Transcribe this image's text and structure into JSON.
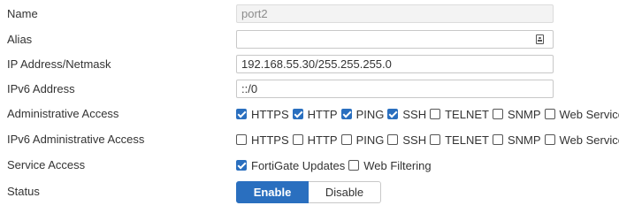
{
  "form": {
    "name": {
      "label": "Name",
      "value": "port2"
    },
    "alias": {
      "label": "Alias",
      "value": "",
      "icon": "address-book-icon"
    },
    "ip_netmask": {
      "label": "IP Address/Netmask",
      "value": "192.168.55.30/255.255.255.0"
    },
    "ipv6_address": {
      "label": "IPv6 Address",
      "value": "::/0"
    },
    "admin_access": {
      "label": "Administrative Access",
      "options": [
        {
          "label": "HTTPS",
          "checked": true
        },
        {
          "label": "HTTP",
          "checked": true
        },
        {
          "label": "PING",
          "checked": true
        },
        {
          "label": "SSH",
          "checked": true
        },
        {
          "label": "TELNET",
          "checked": false
        },
        {
          "label": "SNMP",
          "checked": false
        },
        {
          "label": "Web Service",
          "checked": false
        }
      ]
    },
    "ipv6_admin_access": {
      "label": "IPv6 Administrative Access",
      "options": [
        {
          "label": "HTTPS",
          "checked": false
        },
        {
          "label": "HTTP",
          "checked": false
        },
        {
          "label": "PING",
          "checked": false
        },
        {
          "label": "SSH",
          "checked": false
        },
        {
          "label": "TELNET",
          "checked": false
        },
        {
          "label": "SNMP",
          "checked": false
        },
        {
          "label": "Web Service",
          "checked": false
        }
      ]
    },
    "service_access": {
      "label": "Service Access",
      "options": [
        {
          "label": "FortiGate Updates",
          "checked": true
        },
        {
          "label": "Web Filtering",
          "checked": false
        }
      ]
    },
    "status": {
      "label": "Status",
      "enable_label": "Enable",
      "disable_label": "Disable",
      "selected": "Enable"
    }
  },
  "colors": {
    "accent": "#2a6fbf",
    "text": "#333333",
    "readonly_text": "#8c8c8c",
    "border": "#c8c8c8"
  }
}
